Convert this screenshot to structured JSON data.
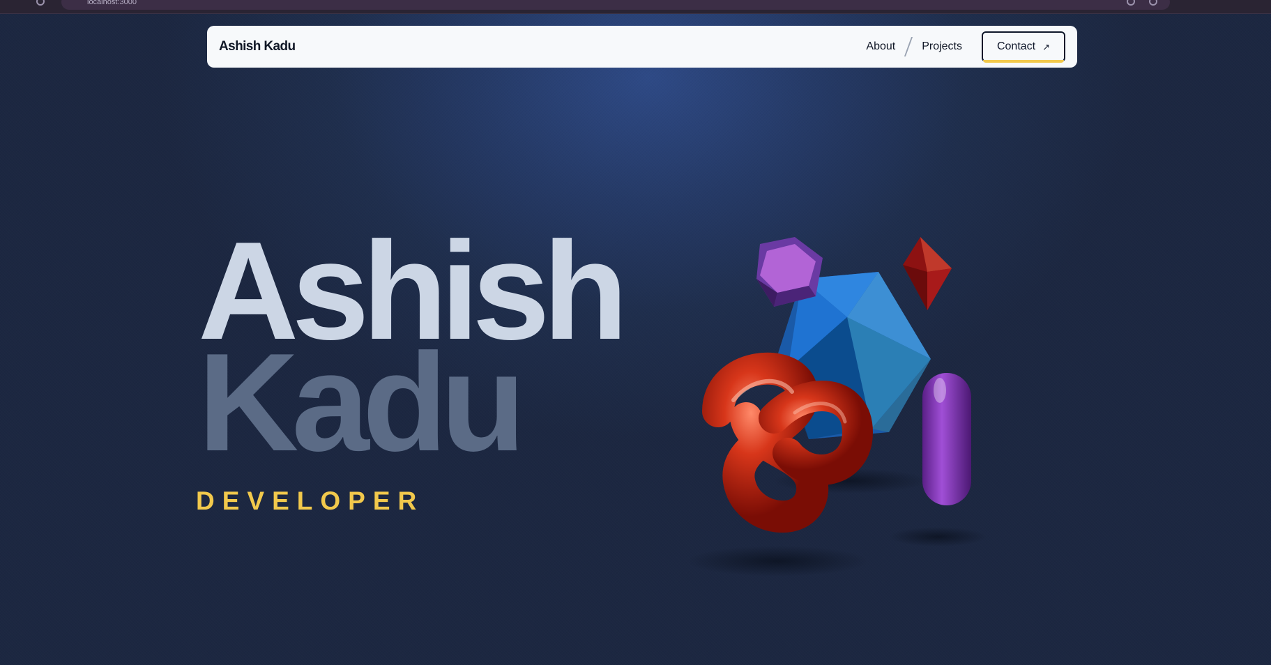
{
  "browser": {
    "address": "localhost:3000"
  },
  "nav": {
    "brand": "Ashish Kadu",
    "links": [
      {
        "label": "About"
      },
      {
        "label": "Projects"
      }
    ],
    "contact_label": "Contact",
    "contact_icon": "arrow-up-right-icon"
  },
  "hero": {
    "first_name": "Ashish",
    "last_name": "Kadu",
    "role": "DEVELOPER"
  },
  "colors": {
    "accent": "#f2c94c",
    "first_name": "#ccd6e5",
    "last_name": "#5b6b86",
    "background": "#1f2e4d"
  }
}
